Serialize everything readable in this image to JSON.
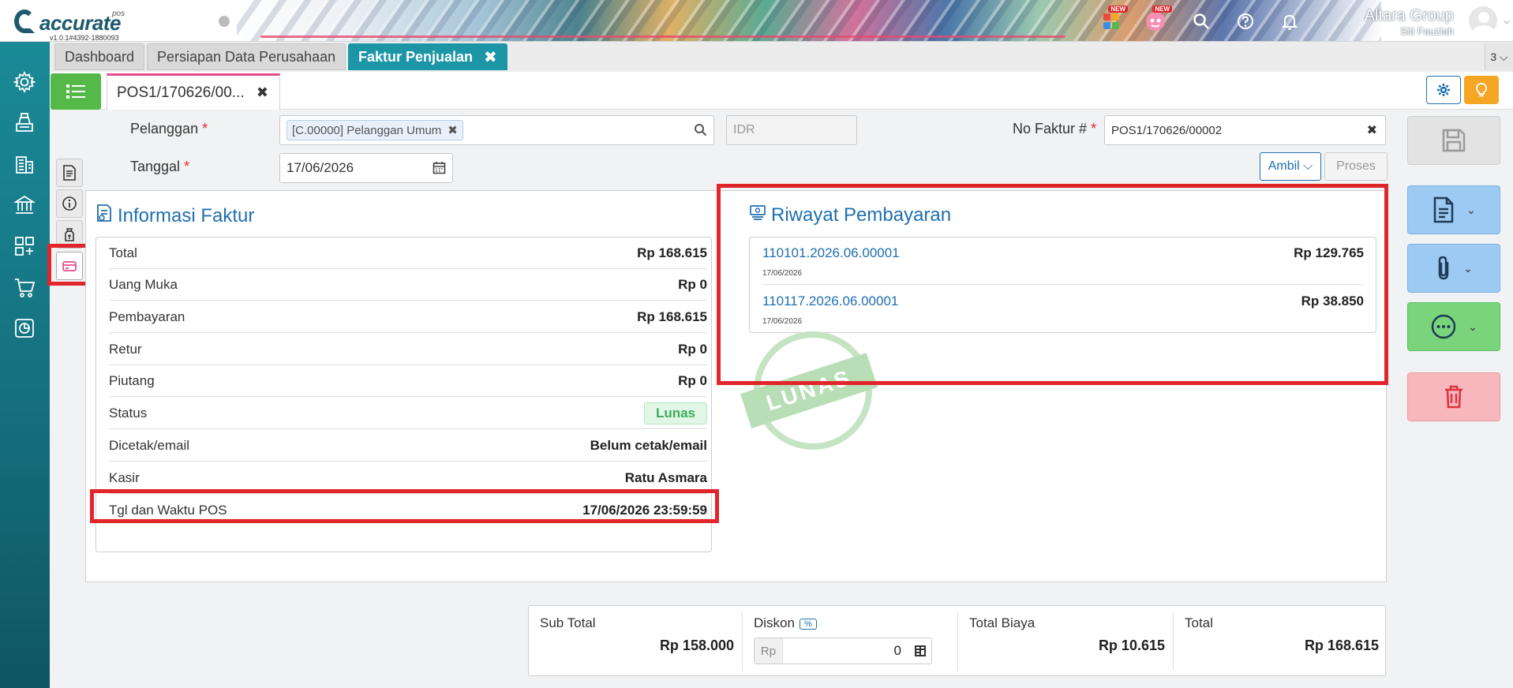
{
  "header": {
    "logo_text": "accurate",
    "logo_sub": "pos",
    "version": "v1.0.1#4392-1880093",
    "company": "Altara Group",
    "user": "Siti Fauziah",
    "new_badge": "NEW"
  },
  "tabs": [
    {
      "label": "Dashboard"
    },
    {
      "label": "Persiapan Data Perusahaan"
    },
    {
      "label": "Faktur Penjualan"
    }
  ],
  "tab_close": "✖",
  "tab_count": "3",
  "doc_tab": {
    "label": "POS1/170626/00...",
    "close": "✖"
  },
  "form": {
    "pelanggan_label": "Pelanggan",
    "pelanggan_value": "[C.00000] Pelanggan Umum",
    "currency": "IDR",
    "no_faktur_label": "No Faktur #",
    "no_faktur_value": "POS1/170626/00002",
    "tanggal_label": "Tanggal",
    "tanggal_value": "17/06/2026",
    "required_mark": "*",
    "ambil_label": "Ambil",
    "proses_label": "Proses"
  },
  "info": {
    "title": "Informasi Faktur",
    "rows": [
      {
        "k": "Total",
        "v": "Rp 168.615"
      },
      {
        "k": "Uang Muka",
        "v": "Rp 0"
      },
      {
        "k": "Pembayaran",
        "v": "Rp 168.615"
      },
      {
        "k": "Retur",
        "v": "Rp 0"
      },
      {
        "k": "Piutang",
        "v": "Rp 0"
      },
      {
        "k": "Status",
        "v": "Lunas"
      },
      {
        "k": "Dicetak/email",
        "v": "Belum cetak/email"
      },
      {
        "k": "Kasir",
        "v": "Ratu Asmara"
      },
      {
        "k": "Tgl dan Waktu POS",
        "v": "17/06/2026 23:59:59"
      }
    ]
  },
  "payments": {
    "title": "Riwayat Pembayaran",
    "items": [
      {
        "no": "110101.2026.06.00001",
        "date": "17/06/2026",
        "amount": "Rp 129.765"
      },
      {
        "no": "110117.2026.06.00001",
        "date": "17/06/2026",
        "amount": "Rp 38.850"
      }
    ],
    "stamp": "LUNAS"
  },
  "totals": {
    "subtotal_label": "Sub Total",
    "subtotal_value": "Rp 158.000",
    "diskon_label": "Diskon",
    "diskon_pct": "%",
    "diskon_prefix": "Rp",
    "diskon_value": "0",
    "biaya_label": "Total Biaya",
    "biaya_value": "Rp 10.615",
    "total_label": "Total",
    "total_value": "Rp 168.615"
  },
  "colors": {
    "teal": "#1c96a6",
    "blue": "#1e6fb0",
    "green": "#54b948",
    "highlight_red": "#e0262b"
  }
}
